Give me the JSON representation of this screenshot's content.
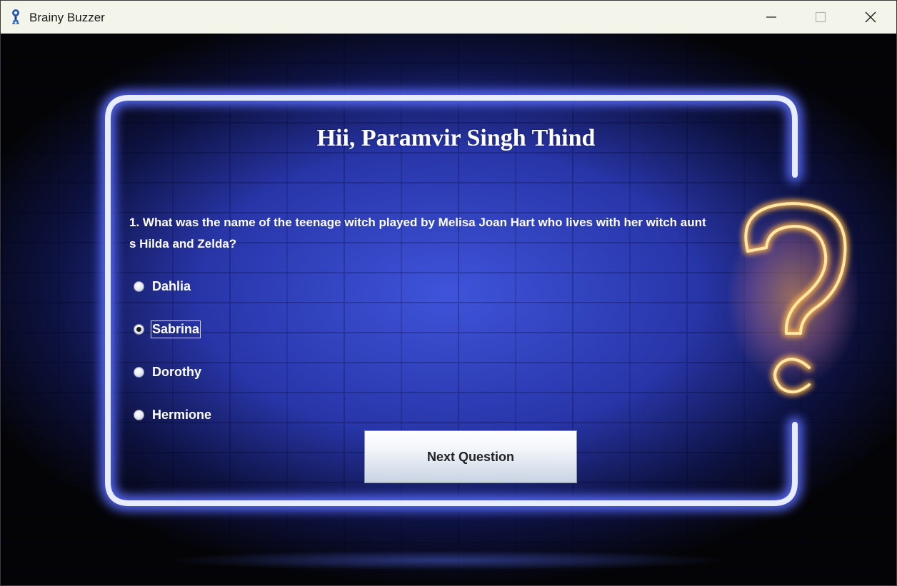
{
  "window": {
    "title": "Brainy Buzzer",
    "icon": "app-icon"
  },
  "controls": {
    "minimize_icon": "minimize-icon",
    "maximize_icon": "maximize-icon",
    "close_icon": "close-icon"
  },
  "quiz": {
    "greeting": "Hii, Paramvir Singh Thind",
    "question": "1. What was the name of the teenage witch played by Melisa Joan Hart who lives with her witch aunts Hilda and Zelda?",
    "options": [
      {
        "label": "Dahlia",
        "selected": false
      },
      {
        "label": "Sabrina",
        "selected": true
      },
      {
        "label": "Dorothy",
        "selected": false
      },
      {
        "label": "Hermione",
        "selected": false
      }
    ],
    "next_button_label": "Next Question"
  },
  "colors": {
    "neon_frame": "#dfe4ff",
    "neon_glow": "#4a5dff",
    "background_panel": "#3d50d0",
    "question_mark": "#ffd27a",
    "titlebar": "#f3f4ea"
  }
}
